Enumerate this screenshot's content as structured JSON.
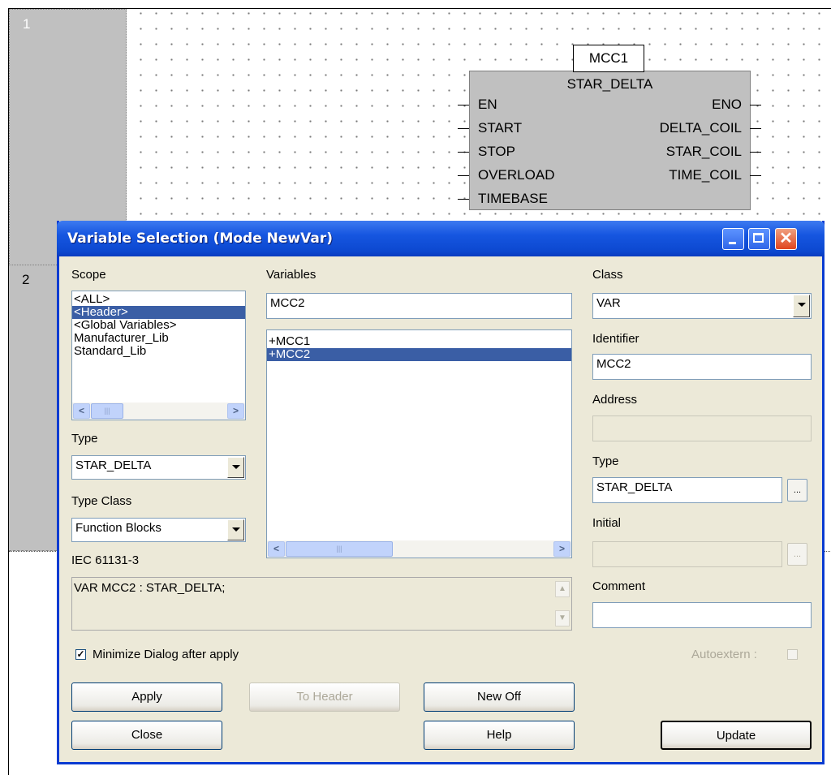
{
  "editor": {
    "rows": [
      "1",
      "2"
    ],
    "function_block": {
      "instance": "MCC1",
      "type": "STAR_DELTA",
      "inputs": [
        "EN",
        "START",
        "STOP",
        "OVERLOAD",
        "TIMEBASE"
      ],
      "outputs": [
        "ENO",
        "DELTA_COIL",
        "STAR_COIL",
        "TIME_COIL"
      ]
    }
  },
  "dialog": {
    "title": "Variable Selection (Mode NewVar)",
    "scope": {
      "label": "Scope",
      "items": [
        "<ALL>",
        "<Header>",
        "<Global Variables>",
        "Manufacturer_Lib",
        "Standard_Lib"
      ],
      "selected": "<Header>"
    },
    "type": {
      "label": "Type",
      "value": "STAR_DELTA"
    },
    "type_class": {
      "label": "Type Class",
      "value": "Function Blocks"
    },
    "iec_label": "IEC 61131-3",
    "iec_text": "VAR MCC2 : STAR_DELTA;",
    "variables": {
      "label": "Variables",
      "input_value": "MCC2",
      "items": [
        "+MCC1",
        "+MCC2"
      ],
      "selected": "+MCC2"
    },
    "class": {
      "label": "Class",
      "value": "VAR"
    },
    "identifier": {
      "label": "Identifier",
      "value": "MCC2"
    },
    "address": {
      "label": "Address",
      "value": ""
    },
    "type_right": {
      "label": "Type",
      "value": "STAR_DELTA"
    },
    "initial": {
      "label": "Initial",
      "value": ""
    },
    "comment": {
      "label": "Comment",
      "value": ""
    },
    "minimize_label": "Minimize  Dialog after apply",
    "minimize_checked": true,
    "autoextern_label": "Autoextern :",
    "buttons": {
      "apply": "Apply",
      "to_header": "To Header",
      "new_off": "New Off",
      "close": "Close",
      "help": "Help",
      "update": "Update",
      "ellipsis": "..."
    },
    "colors": {
      "title_bar": "#0c48d0",
      "selection": "#3a5ea5",
      "dialog_bg": "#ece9d8"
    }
  }
}
